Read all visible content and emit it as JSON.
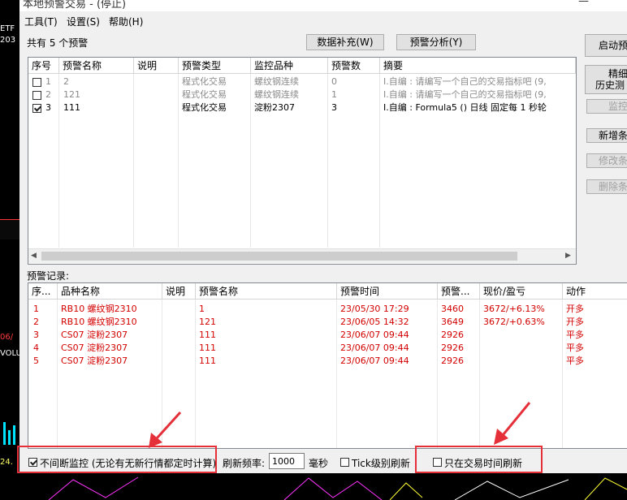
{
  "left_strip": {
    "etf": "ETF",
    "num": "203",
    "v06": "06/",
    "volu": "VOLU",
    "v24": "24."
  },
  "window": {
    "title": "本地预警交易 - (停止)",
    "minimize": "—"
  },
  "menu": [
    "工具(T)",
    "设置(S)",
    "帮助(H)"
  ],
  "top": {
    "summary": "共有 5 个预警",
    "data_fill_btn": "数据补充(W)",
    "analysis_btn": "预警分析(Y)"
  },
  "side_buttons": {
    "start": "启动预",
    "precise_1": "精细",
    "precise_2": "历史测",
    "monitor": "监控",
    "add": "新增条",
    "edit": "修改条",
    "delete": "删除条"
  },
  "alerts_table": {
    "headers": [
      "序号",
      "预警名称",
      "说明",
      "预警类型",
      "监控品种",
      "预警数",
      "摘要"
    ],
    "rows": [
      {
        "checked": false,
        "no": "1",
        "name": "2",
        "desc": "",
        "type": "程式化交易",
        "symbol": "螺纹钢连续",
        "count": "0",
        "summary": "I.自编 : 请编写一个自己的交易指标吧 (9,",
        "style": "gray"
      },
      {
        "checked": false,
        "no": "2",
        "name": "121",
        "desc": "",
        "type": "程式化交易",
        "symbol": "螺纹钢连续",
        "count": "1",
        "summary": "I.自编 : 请编写一个自己的交易指标吧 (9,",
        "style": "gray"
      },
      {
        "checked": true,
        "no": "3",
        "name": "111",
        "desc": "",
        "type": "程式化交易",
        "symbol": "淀粉2307",
        "count": "3",
        "summary": "I.自编 : Formula5 () 日线 固定每 1 秒轮",
        "style": "black"
      }
    ]
  },
  "records": {
    "label": "预警记录:",
    "headers": [
      "序...",
      "品种名称",
      "说明",
      "预警名称",
      "预警时间",
      "预警...",
      "现价/盈亏",
      "动作"
    ],
    "rows": [
      {
        "no": "1",
        "symbol": "RB10 螺纹钢2310",
        "desc": "",
        "name": "1",
        "time": "23/05/30 17:29",
        "price": "3460",
        "pnl": "3672/+6.13%",
        "action": "开多"
      },
      {
        "no": "2",
        "symbol": "RB10 螺纹钢2310",
        "desc": "",
        "name": "121",
        "time": "23/06/05 14:32",
        "price": "3649",
        "pnl": "3672/+0.63%",
        "action": "开多"
      },
      {
        "no": "3",
        "symbol": "CS07 淀粉2307",
        "desc": "",
        "name": "111",
        "time": "23/06/07 09:44",
        "price": "2926",
        "pnl": "",
        "action": "平多"
      },
      {
        "no": "4",
        "symbol": "CS07 淀粉2307",
        "desc": "",
        "name": "111",
        "time": "23/06/07 09:44",
        "price": "2926",
        "pnl": "",
        "action": "平多"
      },
      {
        "no": "5",
        "symbol": "CS07 淀粉2307",
        "desc": "",
        "name": "111",
        "time": "23/06/07 09:44",
        "price": "2926",
        "pnl": "",
        "action": "平多"
      }
    ]
  },
  "footer": {
    "continuous_label": "不间断监控 (无论有无新行情都定时计算)",
    "continuous_checked": true,
    "refresh_label": "刷新频率:",
    "refresh_value": "1000",
    "ms_label": "毫秒",
    "tick_label": "Tick级别刷新",
    "tick_checked": false,
    "trading_only_label": "只在交易时间刷新",
    "trading_only_checked": false
  },
  "colors": {
    "record_text": "#d40000",
    "highlight_box": "#e5303a"
  }
}
